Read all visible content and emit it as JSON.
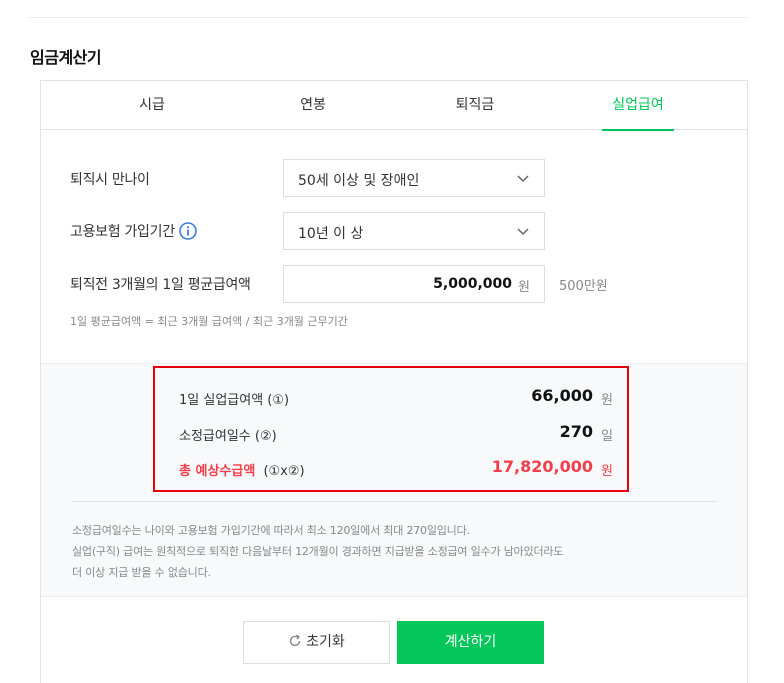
{
  "page": {
    "title": "임금계산기"
  },
  "tabs": [
    {
      "label": "시급",
      "active": false
    },
    {
      "label": "연봉",
      "active": false
    },
    {
      "label": "퇴직금",
      "active": false
    },
    {
      "label": "실업급여",
      "active": true
    }
  ],
  "form": {
    "age": {
      "label": "퇴직시 만나이",
      "value": "50세 이상 및 장애인"
    },
    "insurance": {
      "label": "고용보험 가입기간",
      "value": "10년 이 상"
    },
    "average": {
      "label": "퇴직전 3개월의 1일 평균급여액",
      "value": "5,000,000",
      "unit": "원",
      "hint": "500만원"
    },
    "formula": "1일 평균급여액 = 최근 3개월 급여액 / 최근 3개월 근무기간"
  },
  "result": {
    "daily": {
      "label": "1일 실업급여액 (①)",
      "value": "66,000",
      "unit": "원"
    },
    "days": {
      "label": "소정급여일수 (②)",
      "value": "270",
      "unit": "일"
    },
    "total": {
      "label": "총 예상수급액",
      "suffix": "(①x②)",
      "value": "17,820,000",
      "unit": "원"
    }
  },
  "notes": [
    "소정급여일수는 나이와 고용보험 가입기간에 따라서 최소 120일에서 최대 270일입니다.",
    "실업(구직) 급여는 원칙적으로 퇴직한 다음날부터 12개월이 경과하면 지급받을 소정급여 일수가 남아있더라도",
    "더 이상 지급 받을 수 없습니다."
  ],
  "buttons": {
    "reset": "초기화",
    "calculate": "계산하기"
  },
  "colors": {
    "accent": "#03c75a",
    "highlight": "#f23e4c",
    "border_alert": "#e50010"
  },
  "icons": {
    "dropdown": "chevron-down-icon",
    "info": "info-icon",
    "reset": "refresh-icon"
  }
}
